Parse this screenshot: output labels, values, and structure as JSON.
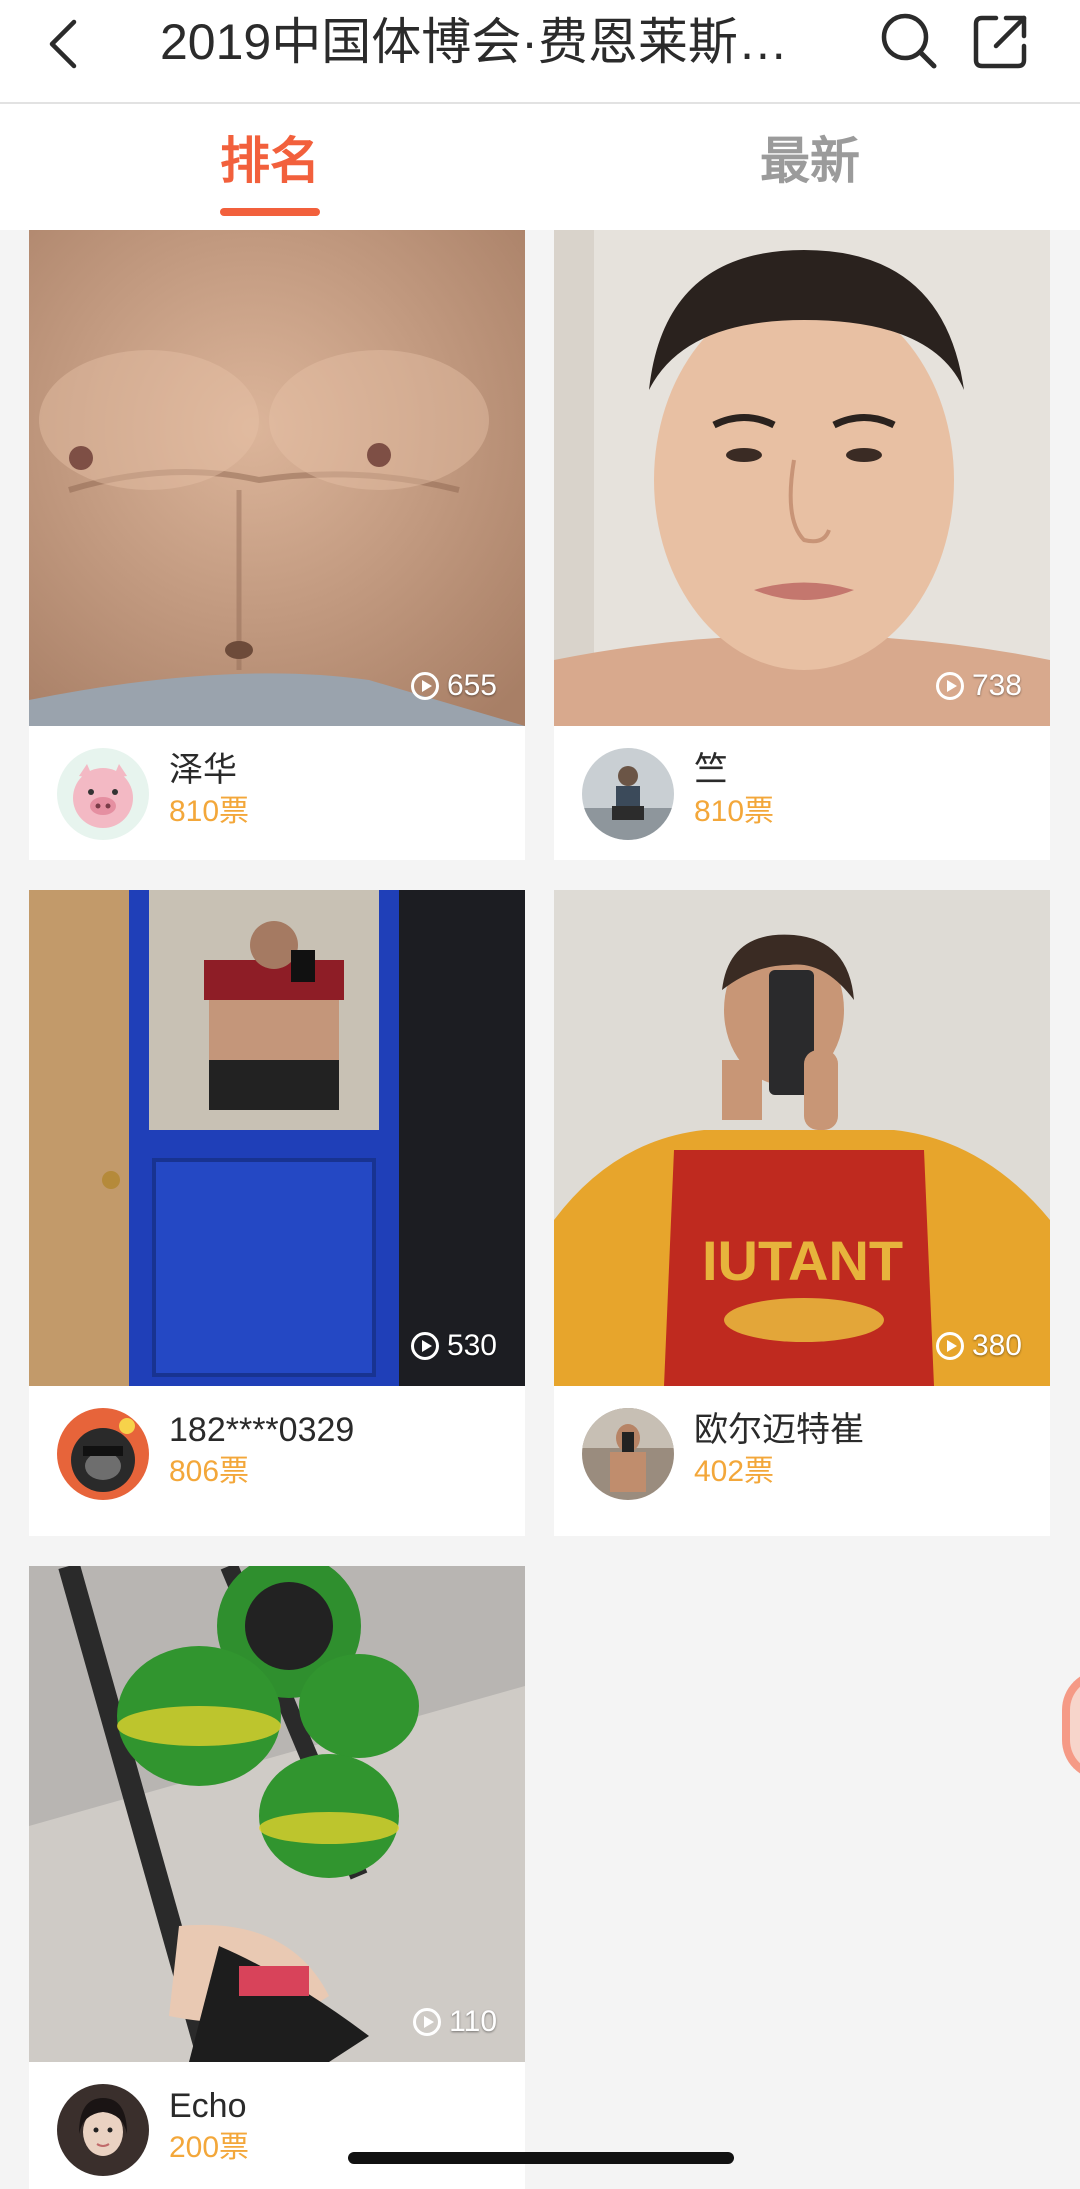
{
  "header": {
    "title": "2019中国体博会·费恩莱斯…",
    "back_icon": "chevron-left-icon",
    "search_icon": "search-icon",
    "share_icon": "share-icon"
  },
  "tabs": [
    {
      "label": "排名",
      "active": true
    },
    {
      "label": "最新",
      "active": false
    }
  ],
  "colors": {
    "accent": "#f2603c",
    "votes": "#f3a73a",
    "inactive_tab": "#9b9b9b"
  },
  "entries": [
    {
      "name": "泽华",
      "votes": "810票",
      "plays": "655"
    },
    {
      "name": "竺",
      "votes": "810票",
      "plays": "738"
    },
    {
      "name": "182****0329",
      "votes": "806票",
      "plays": "530"
    },
    {
      "name": "欧尔迈特崔",
      "votes": "402票",
      "plays": "380"
    },
    {
      "name": "Echo",
      "votes": "200票",
      "plays": "110"
    }
  ]
}
